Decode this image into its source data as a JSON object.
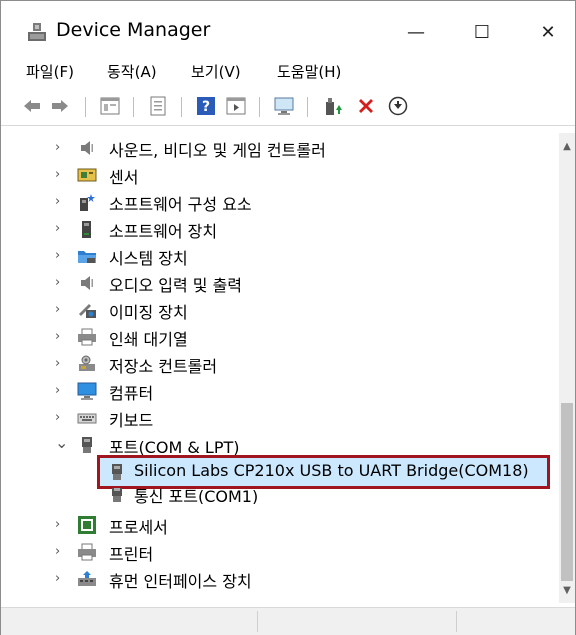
{
  "window": {
    "title": "Device Manager",
    "controls": {
      "minimize": "—",
      "maximize": "☐",
      "close": "✕"
    }
  },
  "menu": [
    {
      "label": "파일(F)"
    },
    {
      "label": "동작(A)"
    },
    {
      "label": "보기(V)"
    },
    {
      "label": "도움말(H)"
    }
  ],
  "tree": {
    "items": [
      {
        "label": "사운드, 비디오 및 게임 컨트롤러",
        "icon": "speaker-icon",
        "expand": "›"
      },
      {
        "label": "센서",
        "icon": "sensor-icon",
        "expand": "›"
      },
      {
        "label": "소프트웨어 구성 요소",
        "icon": "software-component-icon",
        "expand": "›"
      },
      {
        "label": "소프트웨어 장치",
        "icon": "software-device-icon",
        "expand": "›"
      },
      {
        "label": "시스템 장치",
        "icon": "folder-system-icon",
        "expand": "›"
      },
      {
        "label": "오디오 입력 및 출력",
        "icon": "speaker-icon",
        "expand": "›"
      },
      {
        "label": "이미징 장치",
        "icon": "camera-icon",
        "expand": "›"
      },
      {
        "label": "인쇄 대기열",
        "icon": "printer-icon",
        "expand": "›"
      },
      {
        "label": "저장소 컨트롤러",
        "icon": "storage-controller-icon",
        "expand": "›"
      },
      {
        "label": "컴퓨터",
        "icon": "monitor-icon",
        "expand": "›"
      },
      {
        "label": "키보드",
        "icon": "keyboard-icon",
        "expand": "›"
      },
      {
        "label": "포트(COM & LPT)",
        "icon": "port-icon",
        "expand": "⌄"
      }
    ],
    "selected_child": "Silicon Labs CP210x USB to UART Bridge(COM18)",
    "child2": "통신 포트(COM1)",
    "after": [
      {
        "label": "프로세서",
        "icon": "processor-icon",
        "expand": "›"
      },
      {
        "label": "프린터",
        "icon": "printer-icon",
        "expand": "›"
      },
      {
        "label": "휴먼 인터페이스 장치",
        "icon": "hid-icon",
        "expand": "›"
      }
    ]
  },
  "scroll": {
    "up": "▲",
    "down": "▼"
  }
}
